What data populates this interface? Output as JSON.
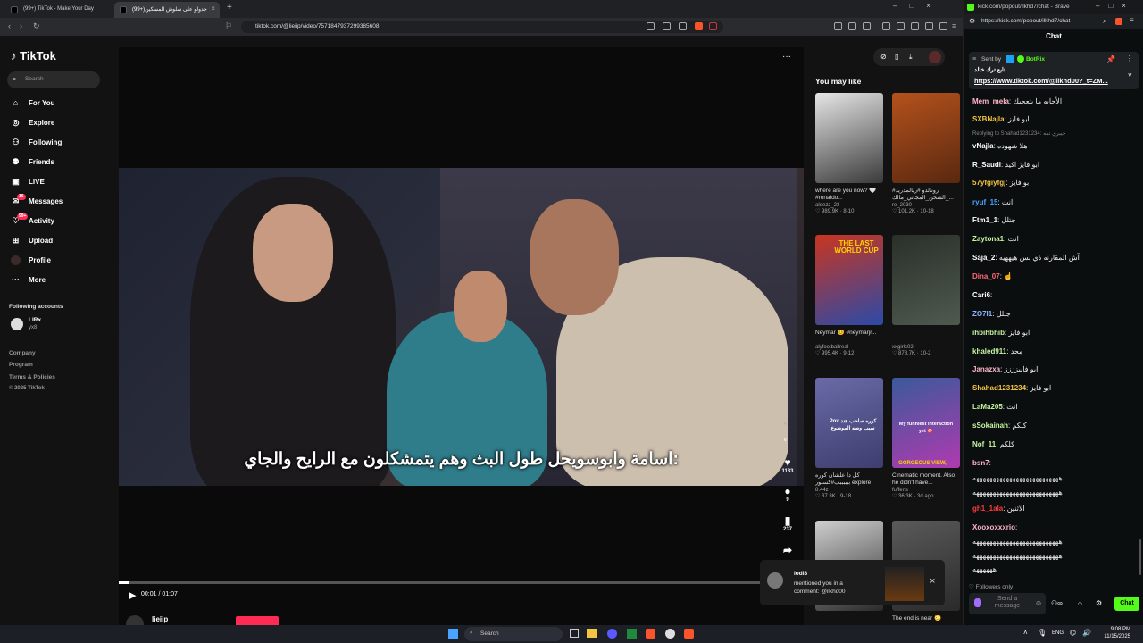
{
  "browser": {
    "tabs": [
      {
        "title": "(99+) TikTok - Make Your Day"
      },
      {
        "title": "(99+)جدولو على سلوش المسكين"
      }
    ],
    "url": "tiktok.com/@lieiip/video/7571847937299385608"
  },
  "tiktok": {
    "logo": "TikTok",
    "search_placeholder": "Search",
    "nav": [
      {
        "label": "For You",
        "icon": "home-icon"
      },
      {
        "label": "Explore",
        "icon": "compass-icon"
      },
      {
        "label": "Following",
        "icon": "following-icon"
      },
      {
        "label": "Friends",
        "icon": "friends-icon"
      },
      {
        "label": "LIVE",
        "icon": "live-icon"
      },
      {
        "label": "Messages",
        "icon": "messages-icon",
        "badge": "16"
      },
      {
        "label": "Activity",
        "icon": "activity-icon",
        "badge": "99+"
      },
      {
        "label": "Upload",
        "icon": "upload-icon"
      },
      {
        "label": "Profile",
        "icon": "profile-icon"
      },
      {
        "label": "More",
        "icon": "more-icon"
      }
    ],
    "following_accounts_title": "Following accounts",
    "following_account": {
      "name": "LIRx",
      "handle": "yx8"
    },
    "footer": [
      "Company",
      "Program",
      "Terms & Policies",
      "© 2025 TikTok"
    ],
    "video": {
      "caption": "اسامة وابوسويحل طول البث وهم يتمشكلون مع الرايح والجاي:",
      "time": "00:01 / 01:07",
      "progress": 0.015,
      "author": "lieiip"
    },
    "actions": {
      "likes": "1133",
      "comments": "9",
      "saves": "237"
    },
    "you_may_like_title": "You may like",
    "recommendations": [
      {
        "title": "where are you now? 🤍 #ronaldo...",
        "author": "aleezz_23",
        "stats": "♡ 989.9K · 8-10",
        "colors": [
          "#e6e6e6",
          "#3a3a3a"
        ]
      },
      {
        "title": "رونالدو #ريالمدريد# الشحن_المجاني_مالك_...",
        "author": "re_2030",
        "stats": "♡ 101.2K · 10-18",
        "colors": [
          "#b4521c",
          "#5a2810"
        ]
      },
      {
        "title": "Neymar 😊 #neymarjr...",
        "author": "alyfootballreal",
        "stats": "♡ 995.4K · 9-12",
        "colors": [
          "#c9351f",
          "#2b4aa8"
        ]
      },
      {
        "title": "",
        "author": "xxgirls02",
        "stats": "♡ 878.7K · 10-2",
        "colors": [
          "#2a2f2a",
          "#4f5a4f"
        ]
      },
      {
        "title": "كل دا علشان كوره ببببببب#كسلور explore",
        "author": "8.44z",
        "stats": "♡ 37.3K · 9-18",
        "colors": [
          "#6a6aa8",
          "#3d3d6e"
        ]
      },
      {
        "title": "Cinematic moment. Also he didn't have...",
        "author": "fuffens",
        "stats": "♡ 36.3K · 3d ago",
        "colors": [
          "#3a5a9a",
          "#b03ab0"
        ]
      },
      {
        "title": "",
        "author": "",
        "stats": "",
        "colors": [
          "#cfcfcf",
          "#2a2a2a"
        ]
      },
      {
        "title": "The end is near 😳",
        "author": "",
        "stats": "",
        "colors": [
          "#5a5a5a",
          "#2a2a2a"
        ]
      }
    ],
    "rec_overlays": {
      "rec3": "THE LAST WORLD CUP",
      "rec5": "Pov كوره صاحب هند سيب وصه الموضوع",
      "rec6": "My funniest interaction yet 🎯",
      "rec6b": "GORGEOUS VIEW, WOW"
    },
    "notification": {
      "user": "lodi3",
      "text": "mentioned you in a comment: @ilkhd00"
    }
  },
  "kick": {
    "window_url": "kick.com/popout/ilkhd7/chat - Brave",
    "url": "https://kick.com/popout/ilkhd7/chat",
    "title": "Chat",
    "pinned": {
      "label": "Sent by",
      "sender": "BotRix",
      "text": "تابع ترك خالد",
      "link": "https://www.tiktok.com/@ilkhd00?_t=ZM..."
    },
    "reply_note": "Replying to Shahad1231234: حيبري تمه",
    "messages": [
      {
        "user": "Mem_mela",
        "color": "#ffb6c8",
        "text": "الأجابه ما بتعجبك"
      },
      {
        "user": "SXBNajla",
        "color": "#f5c542",
        "text": "ابو فايز"
      },
      {
        "user": "vNajla",
        "color": "#ffffff",
        "text": "هلا شهوده"
      },
      {
        "user": "R_Saudi",
        "color": "#ffffff",
        "text": "ابو فايز اكيد"
      },
      {
        "user": "57yfgiyfgj",
        "color": "#f5c542",
        "text": "ابو فايز"
      },
      {
        "user": "ryuf_15",
        "color": "#4aa3ff",
        "text": "انت"
      },
      {
        "user": "Ftm1_1",
        "color": "#ffffff",
        "text": "جتلل"
      },
      {
        "user": "Zaytona1",
        "color": "#c8f5a0",
        "text": "انت"
      },
      {
        "user": "Saja_2",
        "color": "#ffffff",
        "text": "آش المقارنه ذي بس هيههيه"
      },
      {
        "user": "Dina_07",
        "color": "#ff6a7a",
        "text": "☝"
      },
      {
        "user": "Cari6",
        "color": "#ffffff",
        "text": ""
      },
      {
        "user": "ZO7I1",
        "color": "#8ab4ff",
        "text": "جتلل"
      },
      {
        "user": "ihbihbhib",
        "color": "#c8f5a0",
        "text": "ابو فايز"
      },
      {
        "user": "khaled911",
        "color": "#c8f5a0",
        "text": "محد"
      },
      {
        "user": "Janazxa",
        "color": "#ffb6c8",
        "text": "ابو فاييزززز"
      },
      {
        "user": "Shahad1231234",
        "color": "#f5c542",
        "text": "ابو فايز"
      },
      {
        "user": "LaMa205",
        "color": "#c8f5a0",
        "text": "انت"
      },
      {
        "user": "sSokainah",
        "color": "#c8f5a0",
        "text": "كلكم"
      },
      {
        "user": "Nof_11",
        "color": "#c8f5a0",
        "text": "كلكم"
      },
      {
        "user": "bsn7",
        "color": "#ffb6c8",
        "text": ""
      },
      {
        "user": "",
        "color": "#ffffff",
        "text": "ههههههههههههههههههههههههههه"
      },
      {
        "user": "",
        "color": "#ffffff",
        "text": "ههههههههههههههههههههههههههه"
      },
      {
        "user": "gh1_1ala",
        "color": "#ff3b3b",
        "text": "الاثنين"
      },
      {
        "user": "Xooxoxxxrio",
        "color": "#ffb6c8",
        "text": ""
      },
      {
        "user": "",
        "color": "#ffffff",
        "text": "ههههههههههههههههههههههههههه"
      },
      {
        "user": "",
        "color": "#ffffff",
        "text": "ههههههههههههههههههههههههههه"
      },
      {
        "user": "",
        "color": "#ffffff",
        "text": "ههههههه"
      }
    ],
    "followers_only": "Followers only",
    "send_placeholder": "Send a message",
    "chat_button": "Chat"
  },
  "taskbar": {
    "search": "Search",
    "lang": "ENG",
    "time": "9:08 PM",
    "date": "11/15/2025"
  }
}
